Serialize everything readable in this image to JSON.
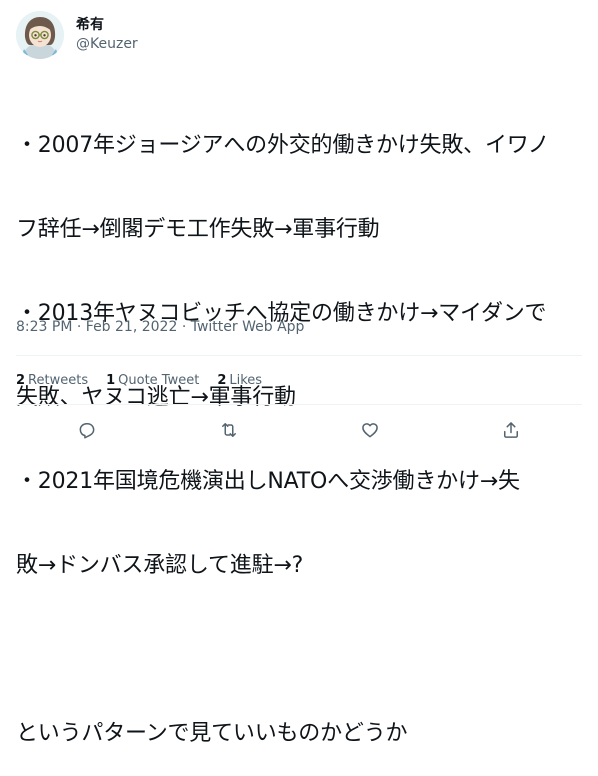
{
  "author": {
    "display_name": "希有",
    "handle": "@Keuzer"
  },
  "tweet": {
    "lines": [
      "・2007年ジョージアへの外交的働きかけ失敗、イワノ",
      "フ辞任→倒閣デモ工作失敗→軍事行動",
      "・2013年ヤヌコビッチへ協定の働きかけ→マイダンで",
      "失敗、ヤヌコ逃亡→軍事行動",
      "・2021年国境危機演出しNATOへ交渉働きかけ→失",
      "敗→ドンバス承認して進駐→?",
      "",
      "というパターンで見ていいものかどうか"
    ]
  },
  "meta": {
    "time": "8:23 PM",
    "sep1": " · ",
    "date": "Feb 21, 2022",
    "sep2": " · ",
    "source": "Twitter Web App"
  },
  "stats": {
    "retweets_count": "2",
    "retweets_label": "Retweets",
    "quote_count": "1",
    "quote_label": "Quote Tweet",
    "likes_count": "2",
    "likes_label": "Likes"
  },
  "actions": {
    "reply_icon": "reply-icon",
    "retweet_icon": "retweet-icon",
    "like_icon": "heart-icon",
    "share_icon": "share-icon"
  },
  "colors": {
    "text": "#0f1419",
    "secondary": "#536471",
    "divider": "#eff3f4"
  }
}
